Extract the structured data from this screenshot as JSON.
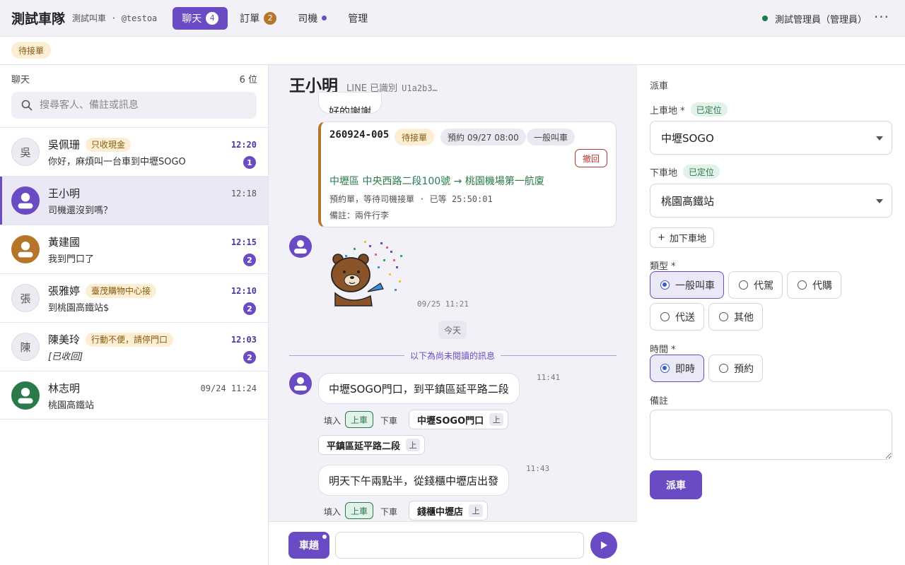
{
  "app": {
    "brand": "測試車隊",
    "subtitle": "測試叫車 · @testoa",
    "user": "測試管理員（管理員）",
    "more": "···"
  },
  "nav": [
    {
      "label": "聊天",
      "badge": "4"
    },
    {
      "label": "訂單",
      "badge": "2"
    },
    {
      "label": "司機"
    },
    {
      "label": "管理"
    }
  ],
  "filter": {
    "chip": "待接單"
  },
  "sidebar": {
    "title": "聊天",
    "count": "6 位",
    "search_placeholder": "搜尋客人、備註或訊息",
    "conversations": [
      {
        "avatar": "吳",
        "name": "吳佩珊",
        "tag": "只收現金",
        "preview": "你好，麻煩叫一台車到中壢SOGO",
        "time": "12:20",
        "unread": "1"
      },
      {
        "name": "王小明",
        "preview": "司機還沒到嗎？",
        "time": "12:18"
      },
      {
        "name": "黃建國",
        "preview": "我到門口了",
        "time": "12:15",
        "unread": "2"
      },
      {
        "avatar": "張",
        "name": "張雅婷",
        "tag": "臺茂購物中心接",
        "preview": "到桃園高鐵站$",
        "time": "12:10",
        "unread": "2"
      },
      {
        "avatar": "陳",
        "name": "陳美玲",
        "tag": "行動不便，請停門口",
        "preview": "[已收回]",
        "time": "12:03",
        "unread": "2"
      },
      {
        "name": "林志明",
        "preview": "桃園高鐵站",
        "time": "09/24 11:24"
      }
    ]
  },
  "chat": {
    "name": "王小明",
    "meta": "LINE 已識別",
    "line_id": "U1a2b3…",
    "partial_text": "好的謝謝",
    "order": {
      "number": "260924-005",
      "status": "待接單",
      "schedule": "預約 09/27 08:00",
      "type": "一般叫車",
      "recall": "撤回",
      "route": "中壢區 中央西路二段100號 → 桃園機場第一航廈",
      "status_line": "預約單，等待司機接單 · 已等 25:50:01",
      "note": "備註：兩件行李"
    },
    "sticker_time": "09/25 11:21",
    "day_separator": "今天",
    "unread_divider": "以下為尚未閱讀的訊息",
    "messages": [
      {
        "text": "中壢SOGO門口，到平鎮區延平路二段",
        "time": "11:41",
        "fill_label": "填入",
        "pickup": "上車",
        "dropoff": "下車",
        "chips": [
          "中壢SOGO門口",
          "平鎮區延平路二段"
        ],
        "chip_tag": "上"
      },
      {
        "text": "明天下午兩點半，從錢櫃中壢店出發",
        "time": "11:43",
        "fill_label": "填入",
        "pickup": "上車",
        "dropoff": "下車",
        "chips": [
          "錢櫃中壢店"
        ],
        "chip_tag": "上"
      }
    ],
    "quick_button": "車趟"
  },
  "dispatch": {
    "title": "派車",
    "pickup_label": "上車地 *",
    "pickup_status": "已定位",
    "pickup_value": "中壢SOGO",
    "dropoff_label": "下車地",
    "dropoff_status": "已定位",
    "dropoff_value": "桃園高鐵站",
    "add_dropoff": "加下車地",
    "type_label": "類型 *",
    "types": [
      "一般叫車",
      "代駕",
      "代購",
      "代送",
      "其他"
    ],
    "selected_type": "一般叫車",
    "time_label": "時間 *",
    "times": [
      "即時",
      "預約"
    ],
    "selected_time": "即時",
    "notes_label": "備註",
    "submit": "派車"
  },
  "colors": {
    "accent": "#6a4bc4",
    "brown": "#b5762a",
    "green": "#2a7a4c",
    "danger": "#bb3333"
  }
}
